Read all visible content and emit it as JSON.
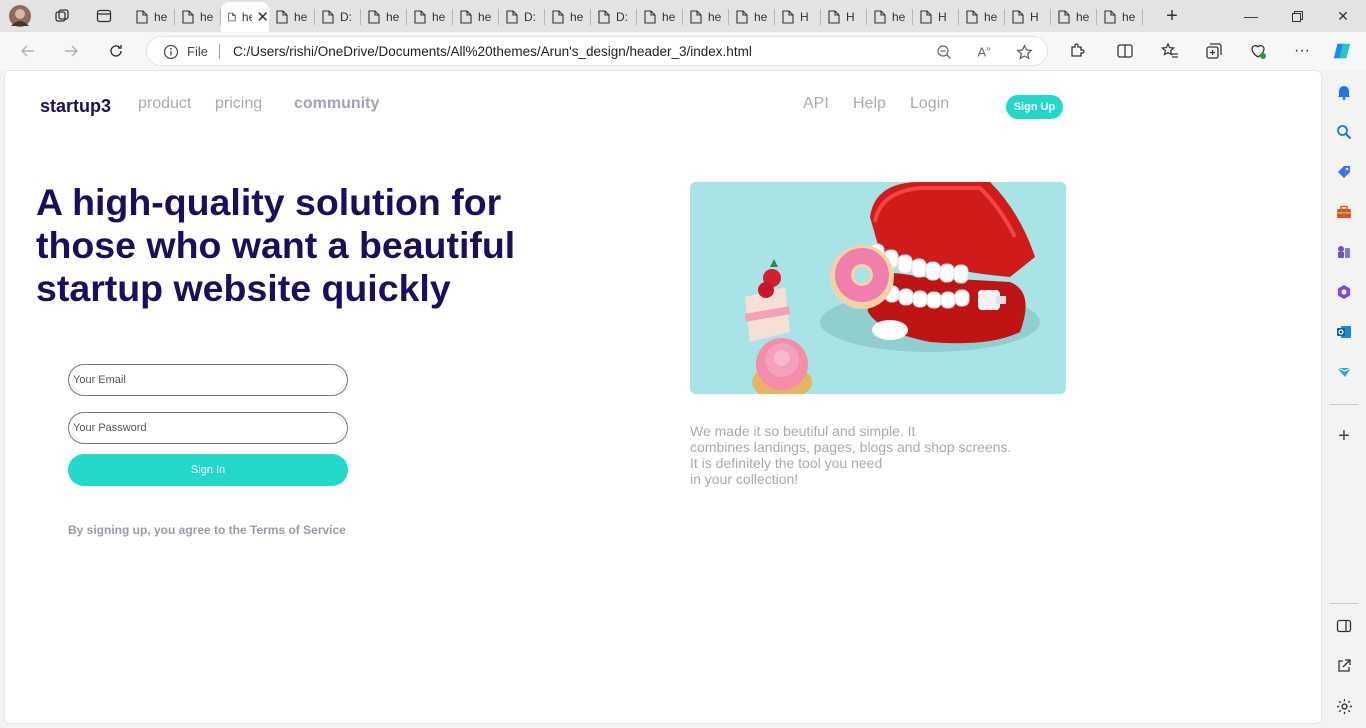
{
  "browser": {
    "tabs": [
      {
        "title": "he",
        "active": false
      },
      {
        "title": "he",
        "active": false
      },
      {
        "title": "he",
        "active": true
      },
      {
        "title": "he",
        "active": false
      },
      {
        "title": "D:",
        "active": false
      },
      {
        "title": "he",
        "active": false
      },
      {
        "title": "he",
        "active": false
      },
      {
        "title": "he",
        "active": false
      },
      {
        "title": "D:",
        "active": false
      },
      {
        "title": "he",
        "active": false
      },
      {
        "title": "D:",
        "active": false
      },
      {
        "title": "he",
        "active": false
      },
      {
        "title": "he",
        "active": false
      },
      {
        "title": "he",
        "active": false
      },
      {
        "title": "H",
        "active": false
      },
      {
        "title": "H",
        "active": false
      },
      {
        "title": "he",
        "active": false
      },
      {
        "title": "H",
        "active": false
      },
      {
        "title": "he",
        "active": false
      },
      {
        "title": "H",
        "active": false
      },
      {
        "title": "he",
        "active": false
      },
      {
        "title": "he",
        "active": false
      }
    ],
    "address": {
      "scheme_label": "File",
      "url": "C:/Users/rishi/OneDrive/Documents/All%20themes/Arun's_design/header_3/index.html"
    },
    "icons": {
      "back": "arrow-left-icon",
      "forward": "arrow-right-icon",
      "refresh": "refresh-icon",
      "info": "info-icon",
      "zoom": "zoom-out-icon",
      "read_aloud": "read-aloud-icon",
      "favorite": "star-icon",
      "extensions": "puzzle-icon",
      "split_screen": "split-screen-icon",
      "favorites": "favorites-icon",
      "collections": "collections-icon",
      "health": "browser-essentials-icon",
      "more": "more-icon",
      "copilot": "copilot-icon"
    },
    "sidebar_icons": [
      "bell-icon",
      "search-icon",
      "tag-icon",
      "toolbox-icon",
      "games-icon",
      "office-icon",
      "outlook-icon",
      "send-icon",
      "add-icon",
      "sidebar-layout-icon",
      "open-external-icon",
      "settings-icon"
    ]
  },
  "page": {
    "brand": "startup3",
    "nav_left": [
      "product",
      "pricing",
      "community"
    ],
    "nav_right": [
      "API",
      "Help",
      "Login"
    ],
    "signup_label": "Sign Up",
    "headline": "A high-quality solution for those who want a beautiful startup website quickly",
    "form": {
      "email_placeholder": "Your Email",
      "password_placeholder": "Your Password",
      "signin_label": "Sign In",
      "terms": "By signing up, you agree to the Terms of Service"
    },
    "description": [
      "We made it so beutiful and simple. It",
      "combines landings, pages, blogs and shop screens.",
      "It is definitely the tool you need",
      "in your collection!"
    ]
  },
  "colors": {
    "accent": "#22d8c8",
    "brand_text": "#1a0f5e",
    "muted_text": "#a8a8b8"
  }
}
